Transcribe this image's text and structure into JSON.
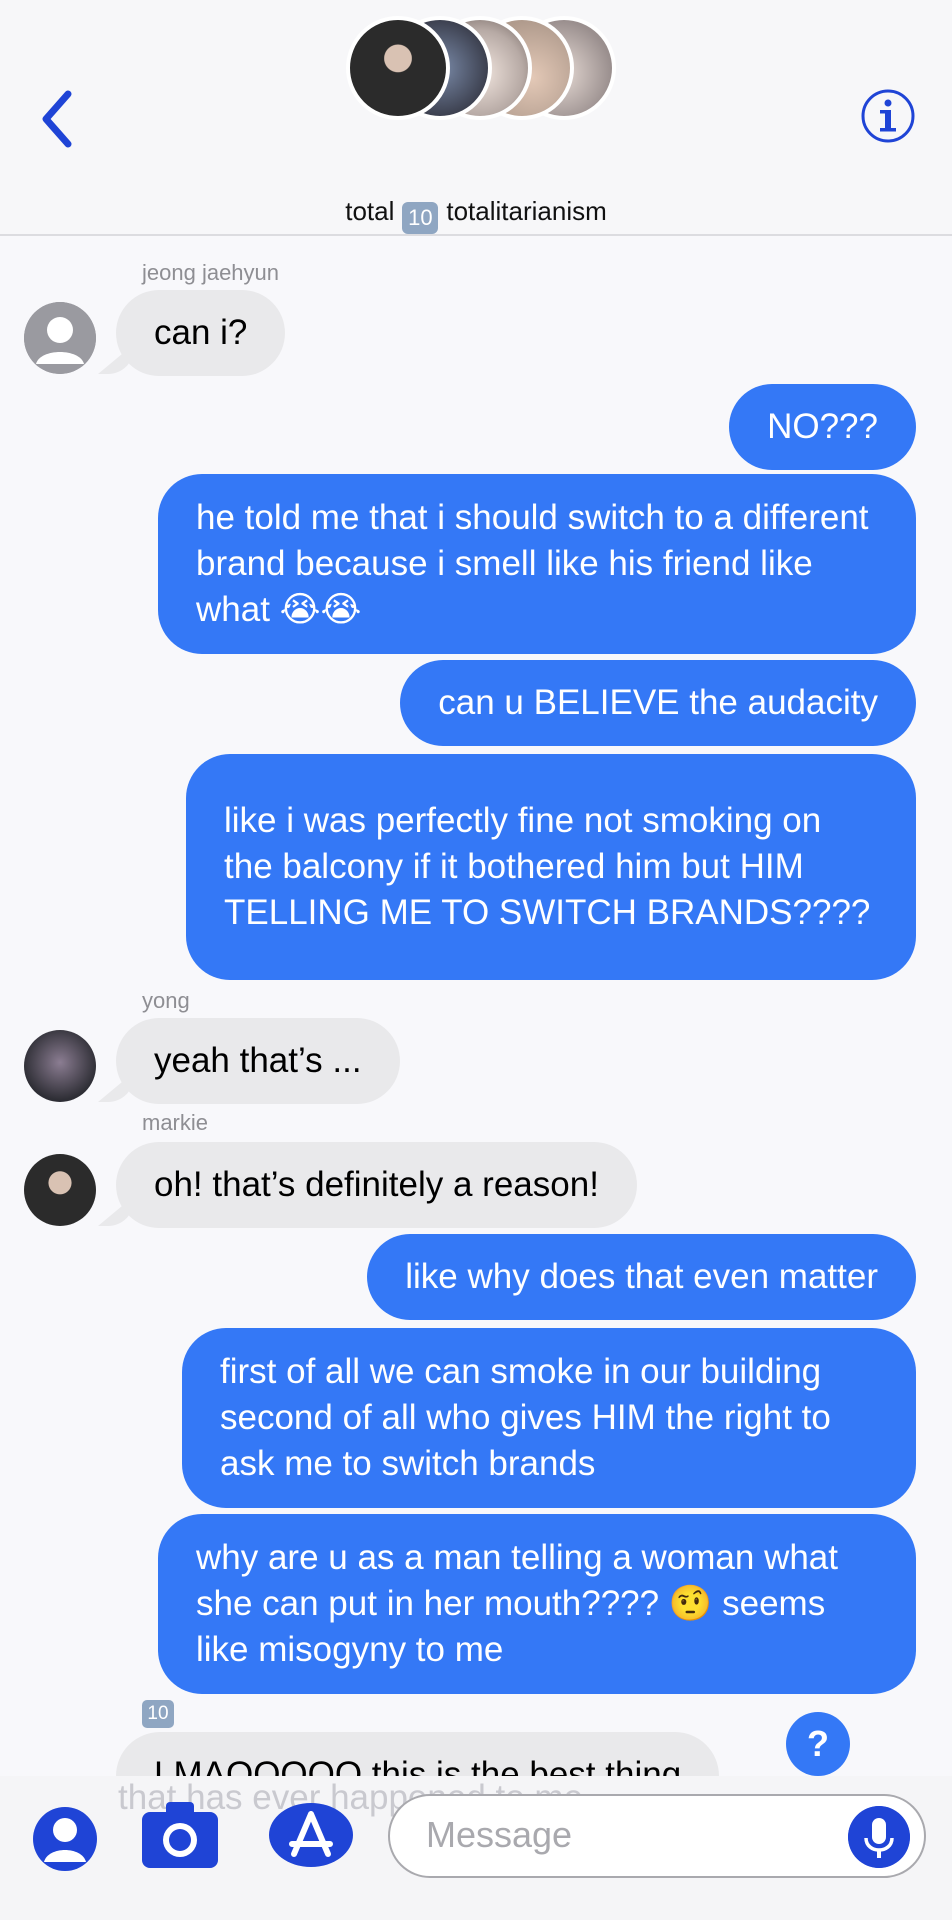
{
  "header": {
    "title_left": "total",
    "title_badge": "10",
    "title_right": "totalitarianism",
    "icons": {
      "back": "chevron-left-icon",
      "info": "info-icon"
    },
    "accent": "#1f44d6"
  },
  "messages": {
    "m1_sender": "jeong jaehyun",
    "m1": "can i?",
    "m2": "NO???",
    "m3": "he told me that i should switch to a different brand because i smell like his friend like what 😭😭",
    "m4": "can u BELIEVE the audacity",
    "m5": "like i was perfectly fine not smoking on the balcony if it bothered him but HIM TELLING ME TO SWITCH BRANDS????",
    "m6_sender": "yong",
    "m6": "yeah that’s ...",
    "m7_sender": "markie",
    "m7": "oh! that’s definitely a reason!",
    "m8": "like why does that even matter",
    "m9": "first of all we can smoke in our building second of all who gives HIM the right to ask me to switch brands",
    "m10": "why are u as a man telling a woman what she can put in her mouth???? 🤨 seems like misogyny to me",
    "m11_sender": "10",
    "m11": "LMAOOOOO this is the best thing",
    "m11_hidden": "that has ever happened to me"
  },
  "colors": {
    "outgoing": "#3478f6",
    "incoming": "#e9e9eb"
  },
  "composer": {
    "placeholder": "Message",
    "icons": [
      "memoji-icon",
      "camera-icon",
      "app-store-icon",
      "microphone-icon"
    ]
  },
  "help_badge": "?"
}
